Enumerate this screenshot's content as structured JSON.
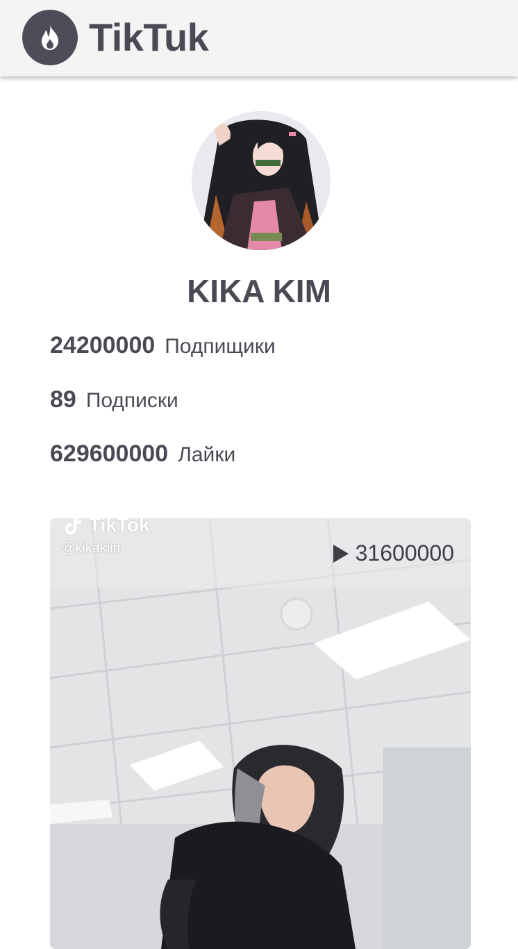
{
  "header": {
    "app_title": "TikTuk",
    "logo_icon": "flame-icon"
  },
  "profile": {
    "name": "KIKA KIM",
    "avatar": "avatar-illustration",
    "stats": [
      {
        "value": "24200000",
        "label": "Подпищики"
      },
      {
        "value": "89",
        "label": "Подписки"
      },
      {
        "value": "629600000",
        "label": "Лайки"
      }
    ]
  },
  "video": {
    "views": "31600000",
    "play_icon": "play-icon",
    "watermark_brand": "TikTok",
    "watermark_handle": "@kikakiim"
  },
  "colors": {
    "header_bg": "#f4f4f4",
    "logo_bg": "#4d4d59",
    "text": "#4a4a55"
  }
}
